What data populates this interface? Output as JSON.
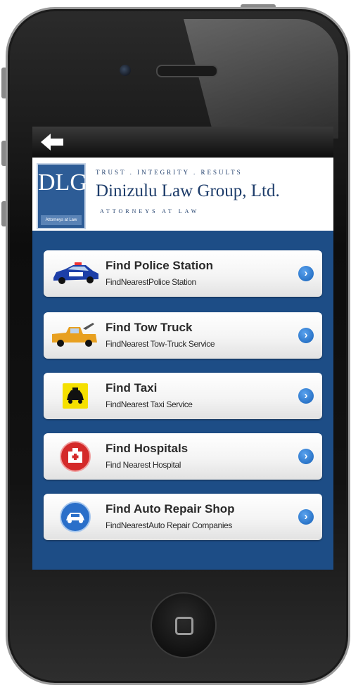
{
  "nav": {
    "back_icon": "back-arrow-icon"
  },
  "header": {
    "logo_letters": "DLG",
    "logo_sub": "Attorneys at Law",
    "tagline": "TRUST . INTEGRITY . RESULTS",
    "firm_name": "Dinizulu Law Group, Ltd.",
    "subtitle": "ATTORNEYS AT LAW"
  },
  "menu": [
    {
      "title": "Find Police Station",
      "subtitle": "FindNearestPolice Station",
      "icon": "police-car-icon"
    },
    {
      "title": "Find Tow Truck",
      "subtitle": "FindNearest Tow-Truck Service",
      "icon": "tow-truck-icon"
    },
    {
      "title": "Find Taxi",
      "subtitle": "FindNearest Taxi Service",
      "icon": "taxi-icon"
    },
    {
      "title": "Find Hospitals",
      "subtitle": "Find Nearest Hospital",
      "icon": "hospital-icon"
    },
    {
      "title": "Find Auto Repair Shop",
      "subtitle": "FindNearestAuto Repair Companies",
      "icon": "auto-repair-icon"
    }
  ],
  "colors": {
    "screen_bg": "#1d4d86",
    "chevron": "#1661b8"
  }
}
